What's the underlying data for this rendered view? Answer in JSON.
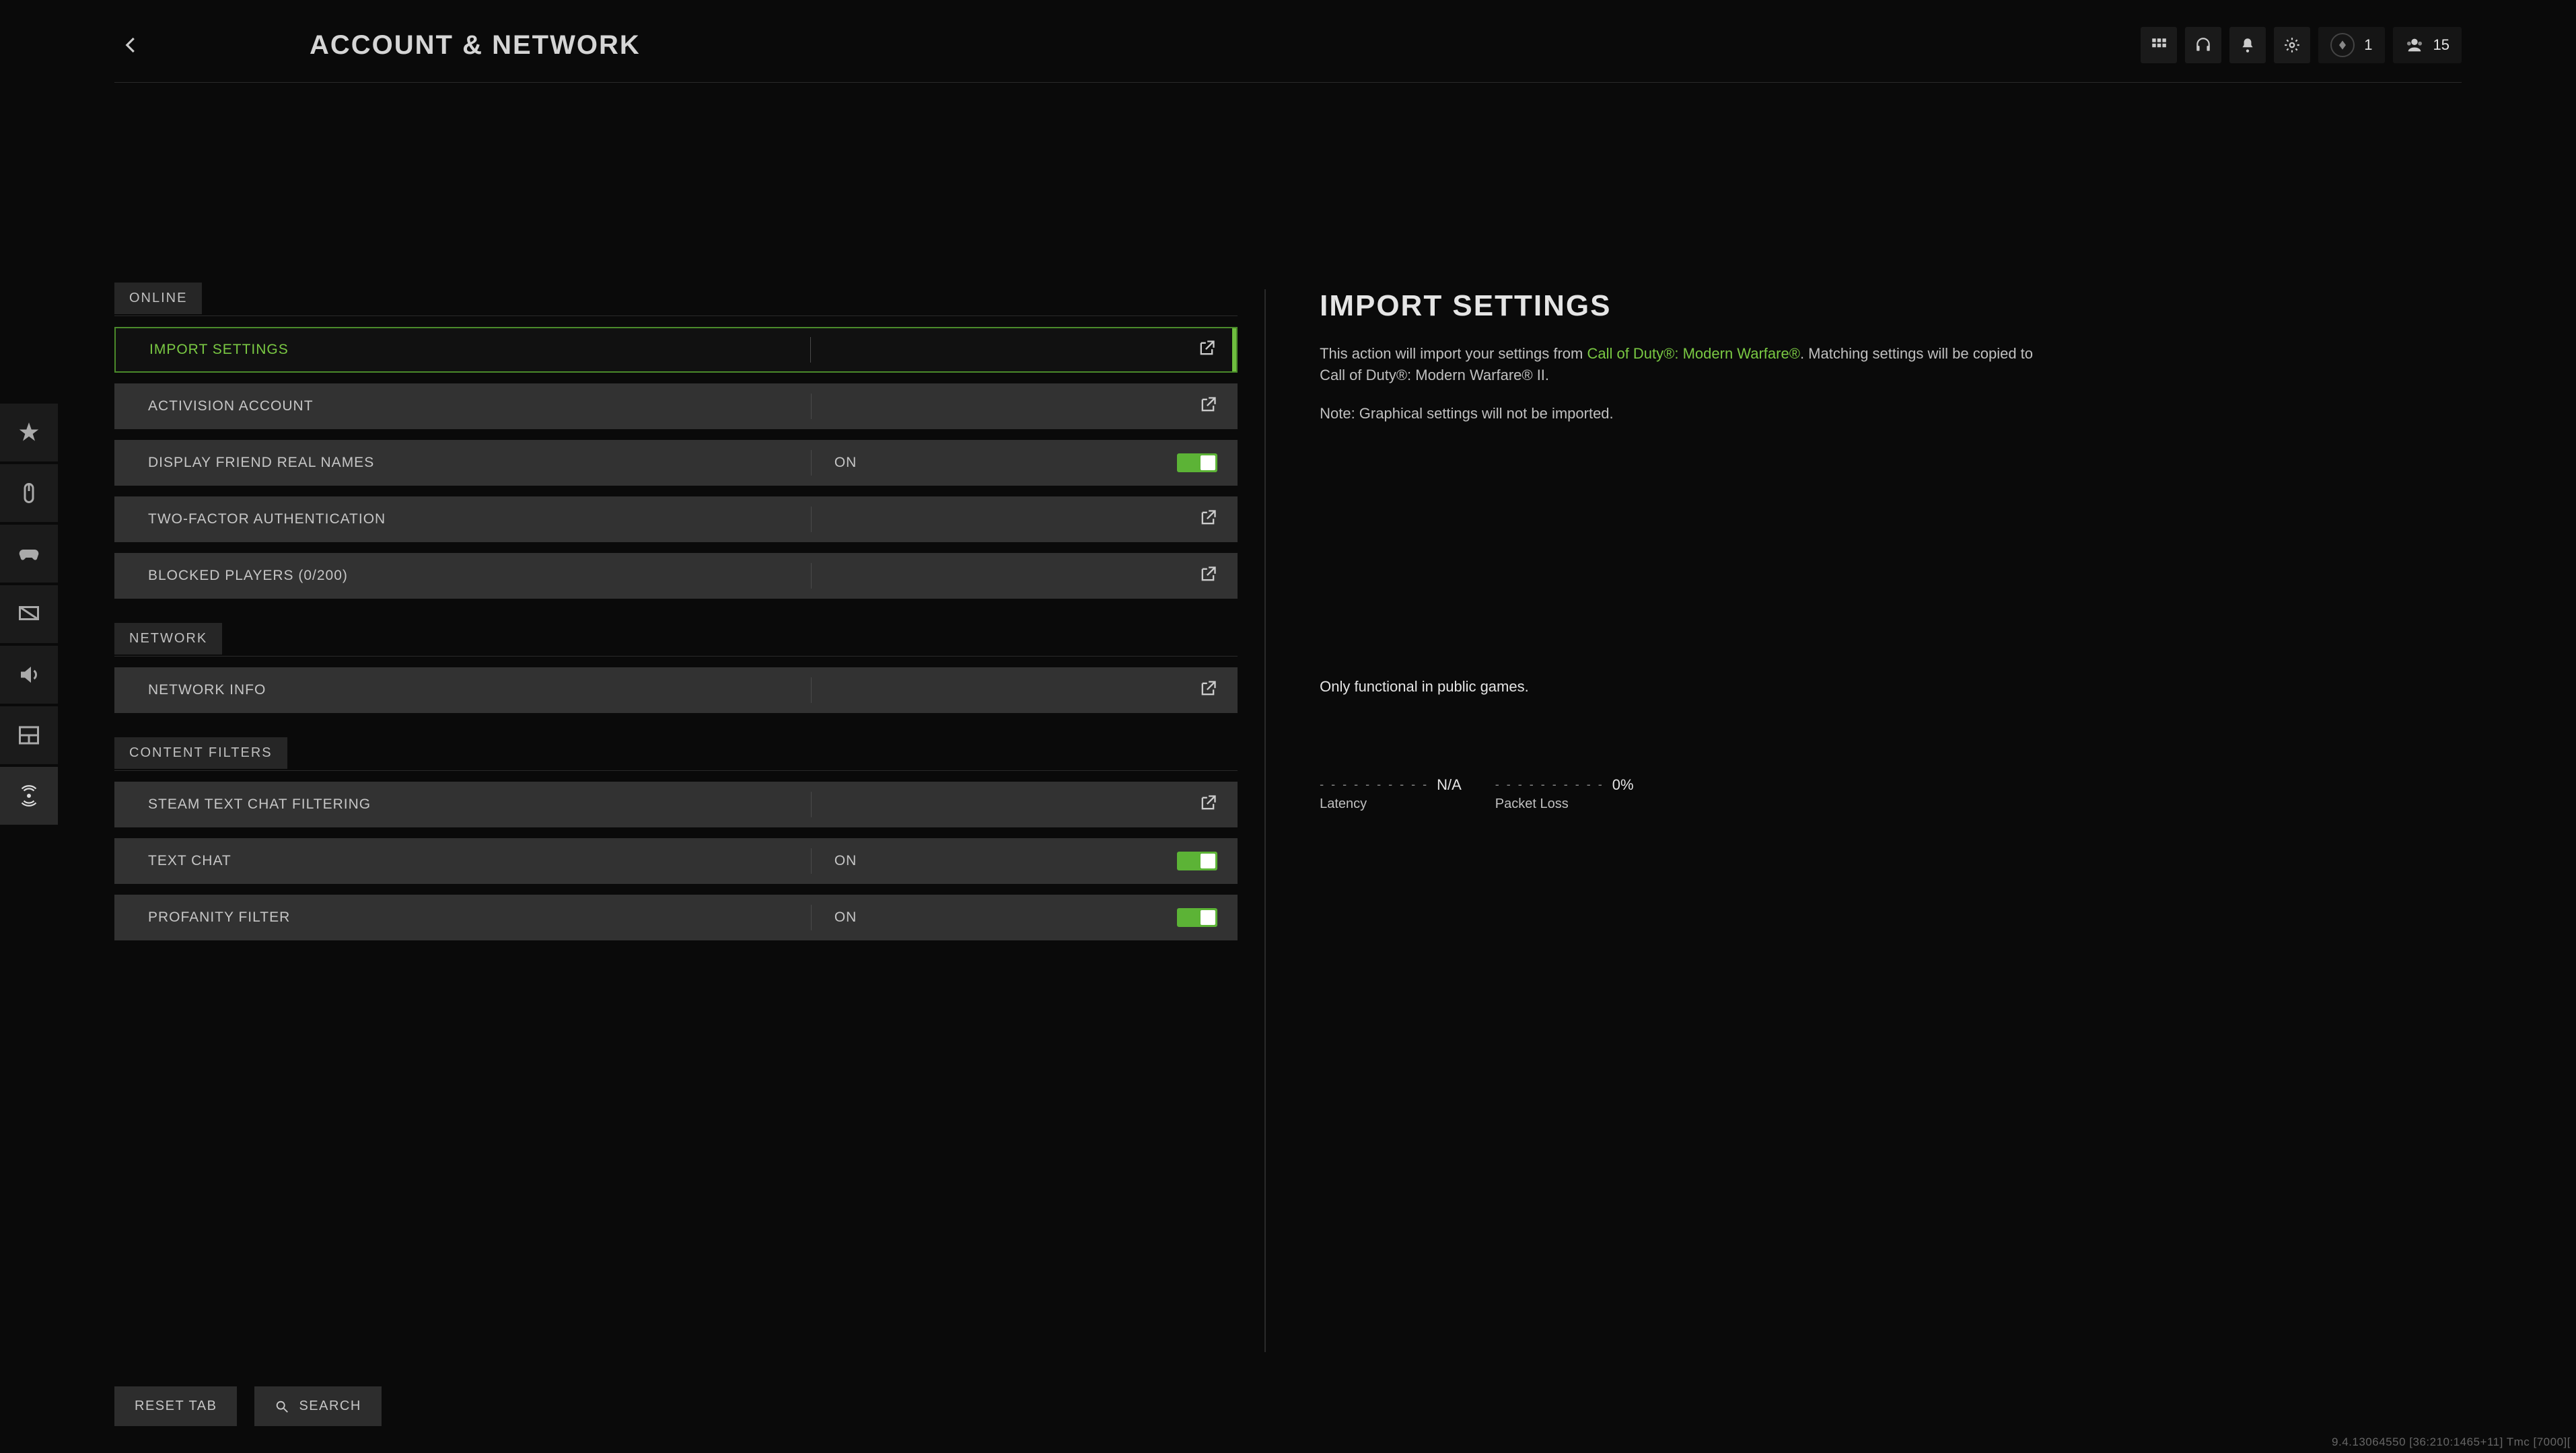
{
  "header": {
    "title": "ACCOUNT & NETWORK",
    "rank_badge": "1",
    "party_count": "15"
  },
  "sections": {
    "online": {
      "label": "ONLINE",
      "import_settings": "IMPORT SETTINGS",
      "activision_account": "ACTIVISION ACCOUNT",
      "display_friend_names": {
        "label": "DISPLAY FRIEND REAL NAMES",
        "value": "ON"
      },
      "two_factor": "TWO-FACTOR AUTHENTICATION",
      "blocked_players": "BLOCKED PLAYERS (0/200)"
    },
    "network": {
      "label": "NETWORK",
      "network_info": "NETWORK INFO"
    },
    "content_filters": {
      "label": "CONTENT FILTERS",
      "steam_chat_filter": "STEAM TEXT CHAT FILTERING",
      "text_chat": {
        "label": "TEXT CHAT",
        "value": "ON"
      },
      "profanity_filter": {
        "label": "PROFANITY FILTER",
        "value": "ON"
      }
    }
  },
  "detail": {
    "title": "IMPORT SETTINGS",
    "desc_prefix": "This action will import your settings from ",
    "desc_game": "Call of Duty®: Modern Warfare®",
    "desc_suffix": ". Matching settings will be copied to Call of Duty®: Modern Warfare® II.",
    "note": "Note: Graphical settings will not be imported.",
    "functional": "Only functional in public games.",
    "latency": {
      "label": "Latency",
      "value": "N/A",
      "dashes": "- - - - - - - - - -"
    },
    "packet_loss": {
      "label": "Packet Loss",
      "value": "0%",
      "dashes": "- - - - - - - - - -"
    }
  },
  "footer": {
    "reset": "RESET TAB",
    "search": "SEARCH"
  },
  "build": "9.4.13064550 [36:210:1465+11] Tmc [7000]["
}
